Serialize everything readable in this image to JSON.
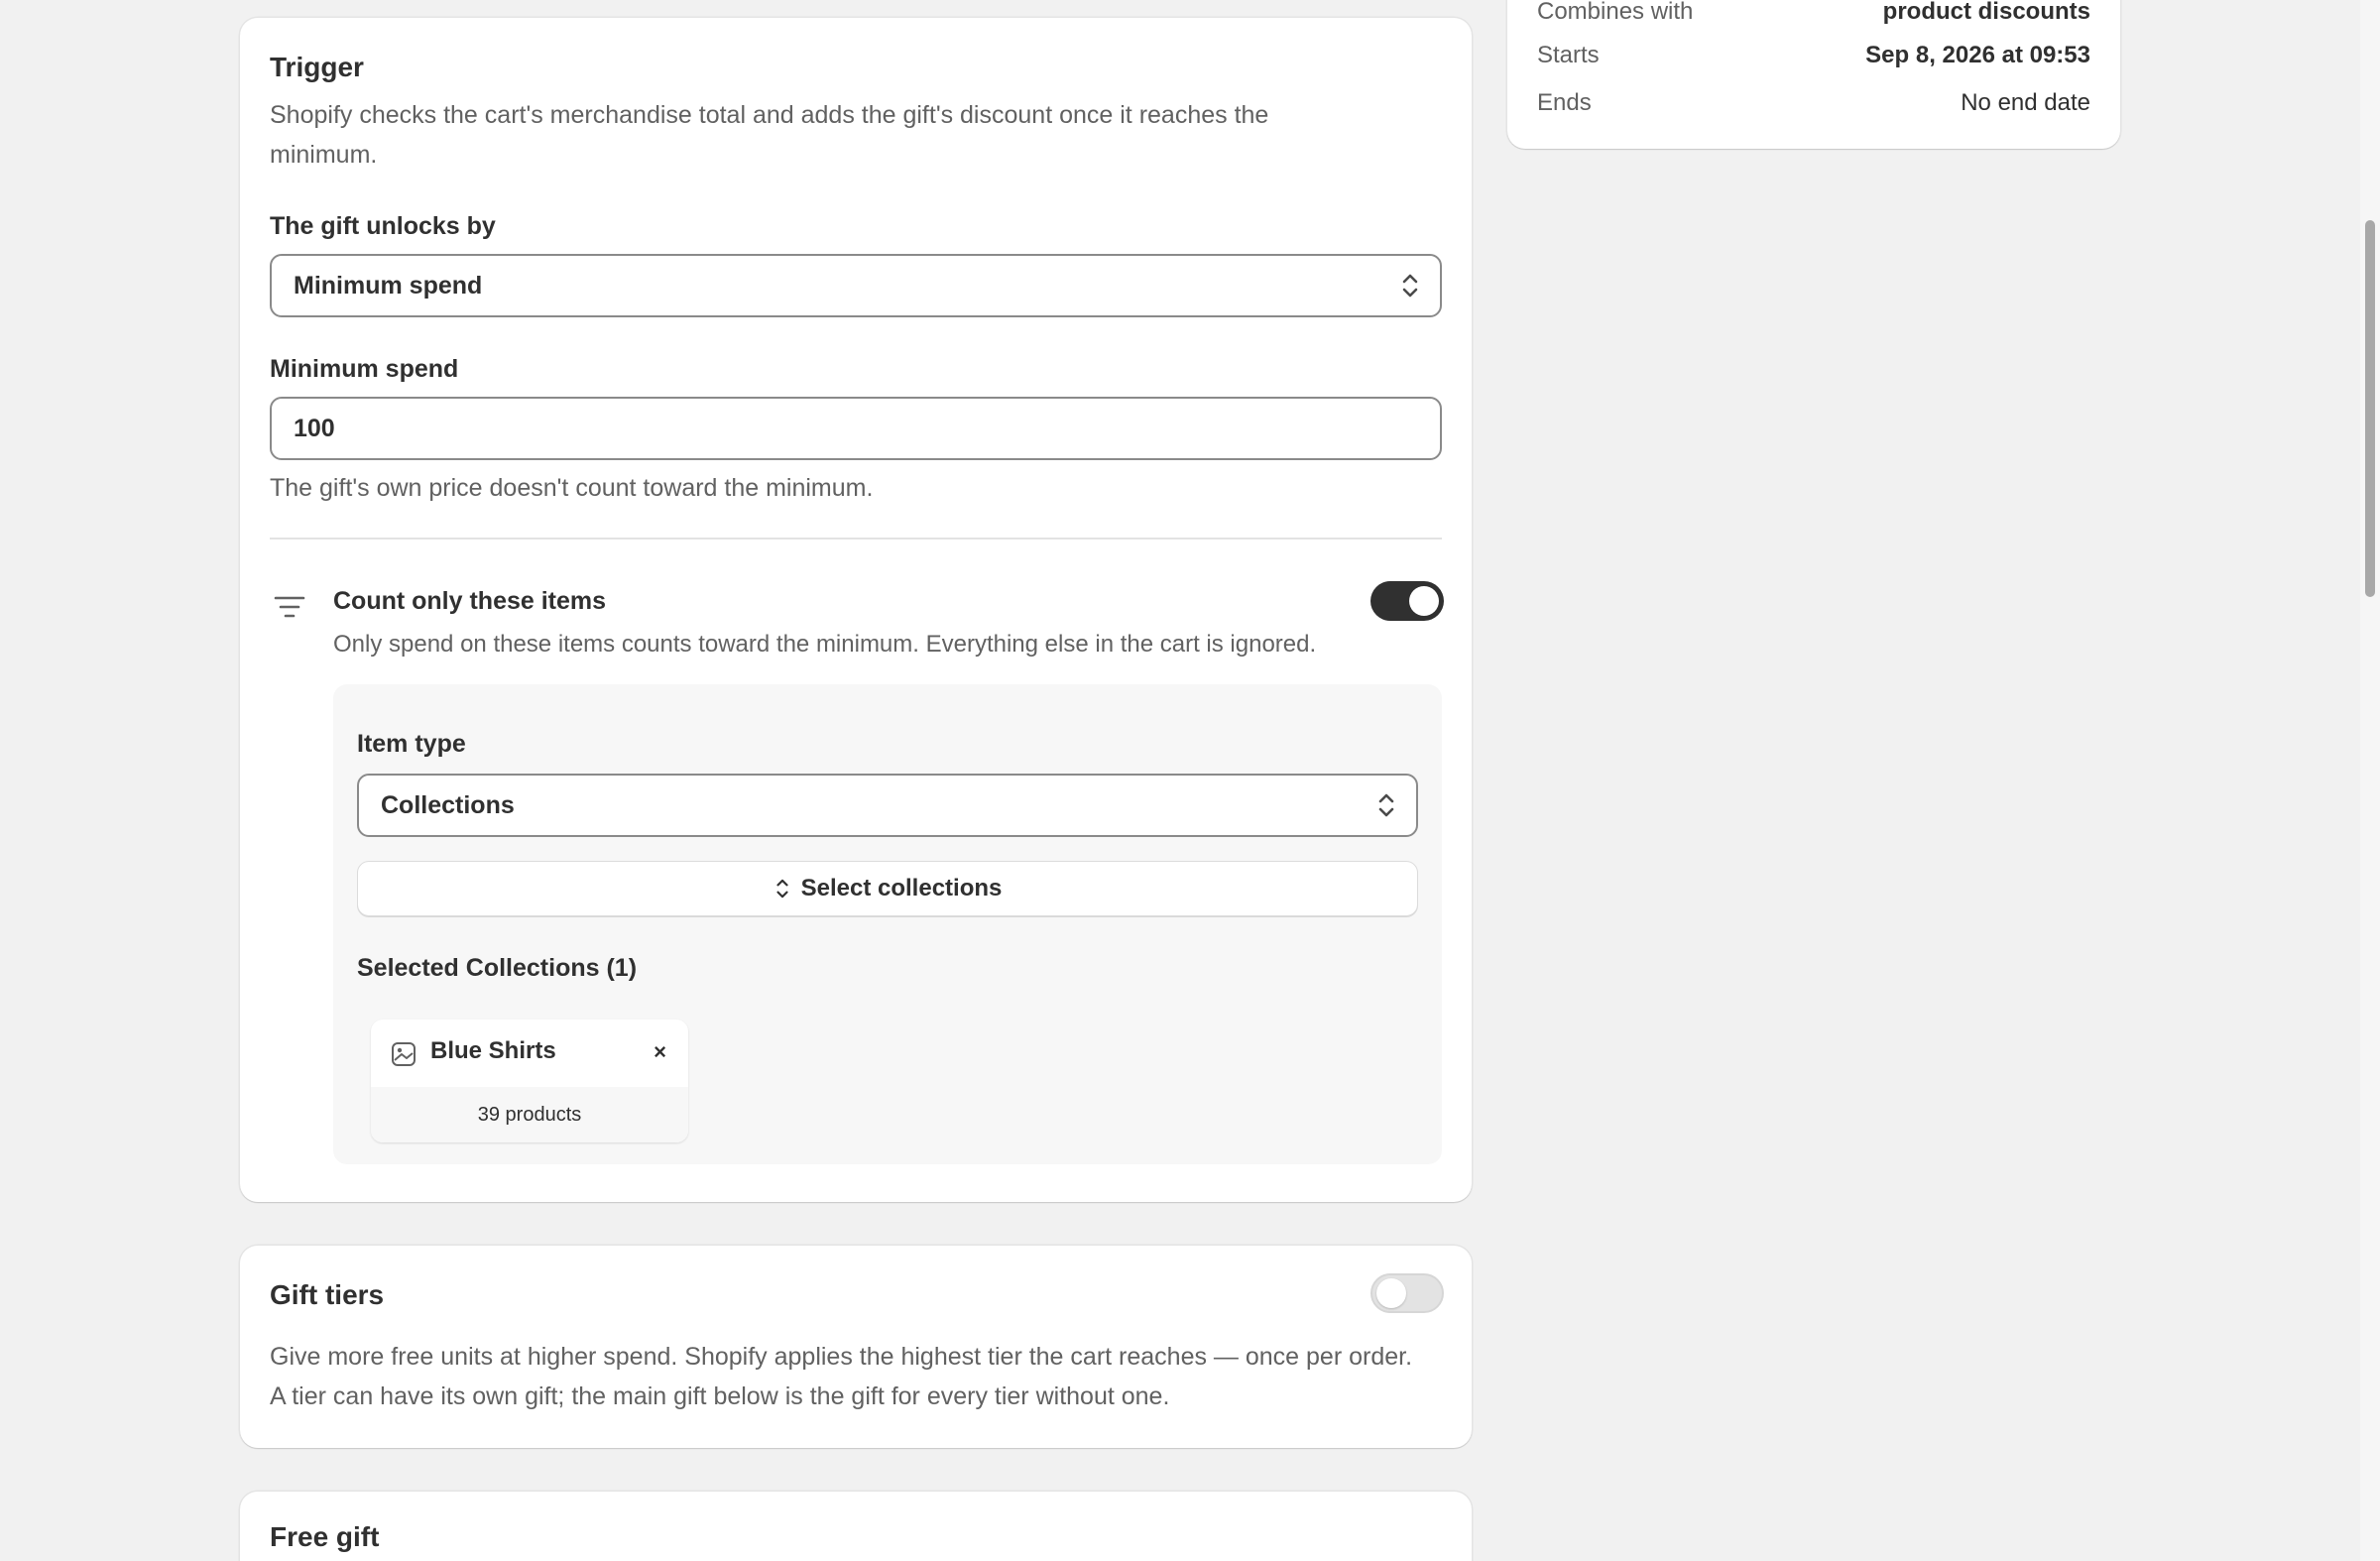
{
  "summary": {
    "combines_label": "Combines with",
    "combines_value": "product discounts",
    "starts_label": "Starts",
    "starts_value": "Sep 8, 2026 at 09:53",
    "ends_label": "Ends",
    "ends_value": "No end date"
  },
  "trigger": {
    "title": "Trigger",
    "description": "Shopify checks the cart's merchandise total and adds the gift's discount once it reaches the minimum.",
    "unlock_label": "The gift unlocks by",
    "unlock_value": "Minimum spend",
    "min_spend_label": "Minimum spend",
    "min_spend_value": "100",
    "min_spend_help": "The gift's own price doesn't count toward the minimum.",
    "count_only_title": "Count only these items",
    "count_only_desc": "Only spend on these items counts toward the minimum. Everything else in the cart is ignored.",
    "count_only_enabled": true,
    "item_type_label": "Item type",
    "item_type_value": "Collections",
    "select_button": "Select collections",
    "selected_heading": "Selected Collections (1)",
    "collections": [
      {
        "name": "Blue Shirts",
        "count": "39 products"
      }
    ]
  },
  "gift_tiers": {
    "title": "Gift tiers",
    "enabled": false,
    "description": "Give more free units at higher spend. Shopify applies the highest tier the cart reaches — once per order. A tier can have its own gift; the main gift below is the gift for every tier without one."
  },
  "free_gift": {
    "title": "Free gift"
  },
  "colors": {
    "toggle_on": "#303030",
    "toggle_off": "#e3e3e3",
    "page_bg": "#f1f1f1"
  }
}
